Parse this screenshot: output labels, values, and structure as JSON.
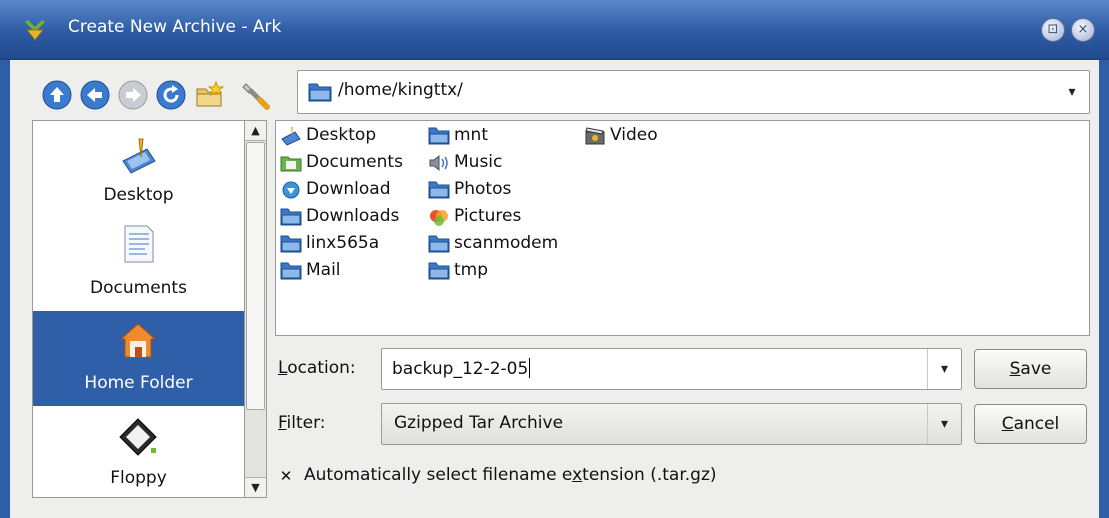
{
  "window": {
    "title": "Create New Archive - Ark",
    "maximize_glyph": "⊡",
    "close_glyph": "×"
  },
  "toolbar": {
    "buttons": [
      "arrow-up-icon",
      "arrow-left-icon",
      "arrow-right-icon",
      "reload-icon",
      "new-folder-icon",
      "configure-icon"
    ],
    "path": "/home/kingttx/",
    "path_dropdown_glyph": "▾"
  },
  "places": {
    "items": [
      {
        "label": "Desktop",
        "icon": "desktop-icon"
      },
      {
        "label": "Documents",
        "icon": "documents-icon"
      },
      {
        "label": "Home Folder",
        "icon": "home-folder-icon",
        "selected": true
      },
      {
        "label": "Floppy",
        "icon": "floppy-icon"
      }
    ]
  },
  "files": {
    "columns": [
      [
        {
          "name": "Desktop",
          "icon": "desktop-small-icon"
        },
        {
          "name": "Documents",
          "icon": "documents-folder-icon"
        },
        {
          "name": "Download",
          "icon": "download-folder-icon"
        },
        {
          "name": "Downloads",
          "icon": "folder-icon"
        },
        {
          "name": "linx565a",
          "icon": "folder-icon"
        },
        {
          "name": "Mail",
          "icon": "folder-icon"
        }
      ],
      [
        {
          "name": "mnt",
          "icon": "folder-icon"
        },
        {
          "name": "Music",
          "icon": "music-folder-icon"
        },
        {
          "name": "Photos",
          "icon": "folder-icon"
        },
        {
          "name": "Pictures",
          "icon": "pictures-folder-icon"
        },
        {
          "name": "scanmodem",
          "icon": "folder-icon"
        },
        {
          "name": "tmp",
          "icon": "folder-icon"
        }
      ],
      [
        {
          "name": "Video",
          "icon": "video-folder-icon"
        }
      ]
    ]
  },
  "form": {
    "location_label_ul": "L",
    "location_label_rest": "ocation:",
    "location_value": "backup_12-2-05",
    "filter_label_ul": "F",
    "filter_label_rest": "ilter:",
    "filter_value": "Gzipped Tar Archive",
    "dropdown_glyph": "▾",
    "save_ul": "S",
    "save_rest": "ave",
    "cancel_ul": "C",
    "cancel_rest": "ancel",
    "checkbox_mark": "✕",
    "checkbox_checked": true,
    "checkbox_label_a": "Automatically select filename e",
    "checkbox_label_ul": "x",
    "checkbox_label_b": "tension (.tar.gz)"
  },
  "colors": {
    "titlebar": "#2d5aa3",
    "selection": "#2f5fa8",
    "folder": "#3b78c7"
  }
}
